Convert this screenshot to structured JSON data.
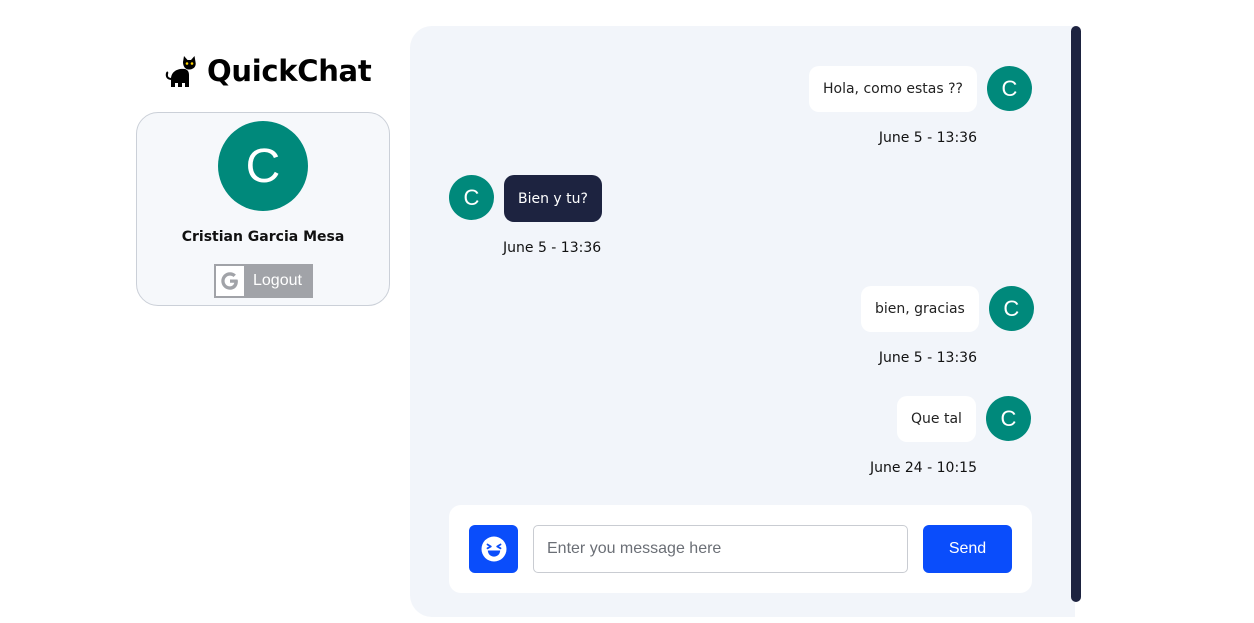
{
  "app": {
    "name": "QuickChat",
    "logo_icon": "cat-icon"
  },
  "profile": {
    "avatar_initial": "C",
    "name": "Cristian Garcia Mesa",
    "logout_label": "Logout",
    "logout_icon": "google-g-icon"
  },
  "messages": [
    {
      "direction": "outgoing",
      "avatar_initial": "C",
      "text": "Hola, como estas ??",
      "time": "June 5 - 13:36"
    },
    {
      "direction": "incoming",
      "avatar_initial": "C",
      "text": "Bien y tu?",
      "time": "June 5 - 13:36"
    },
    {
      "direction": "outgoing",
      "avatar_initial": "C",
      "text": "bien, gracias",
      "time": "June 5 - 13:36"
    },
    {
      "direction": "outgoing",
      "avatar_initial": "C",
      "text": "Que tal",
      "time": "June 24 - 10:15"
    }
  ],
  "composer": {
    "emoji_icon": "laughing-face-icon",
    "input_value": "",
    "placeholder": "Enter you message here",
    "send_label": "Send"
  },
  "colors": {
    "accent": "#0a4dfb",
    "avatar": "#00897b",
    "incoming_bubble": "#1d2340",
    "panel_bg": "#f2f5fa"
  }
}
